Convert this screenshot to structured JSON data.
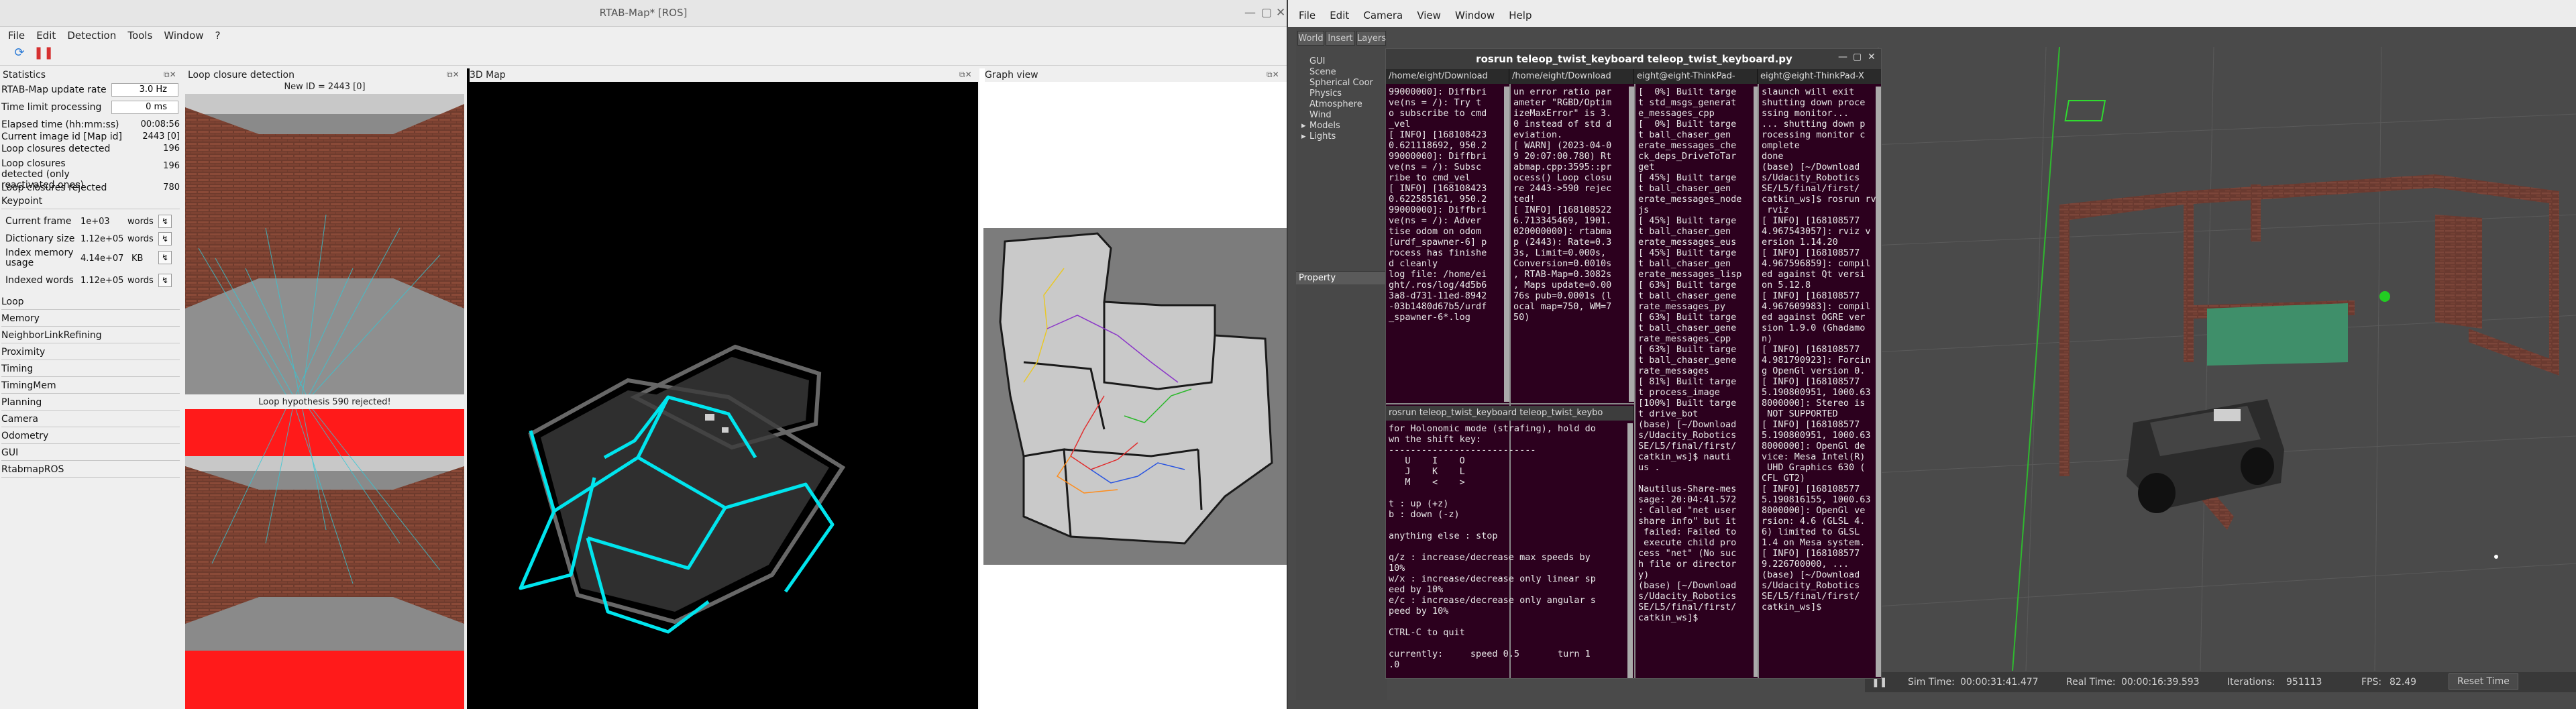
{
  "rtab": {
    "title": "RTAB-Map* [ROS]",
    "menu": [
      "File",
      "Edit",
      "Detection",
      "Tools",
      "Window",
      "?"
    ],
    "panels": {
      "statistics": "Statistics",
      "loop_closure": "Loop closure detection",
      "map3d": "3D Map",
      "graph": "Graph view"
    },
    "stats": {
      "update_rate_label": "RTAB-Map update rate",
      "update_rate_value": "3.0 Hz",
      "time_limit_label": "Time limit processing",
      "time_limit_value": "0 ms",
      "elapsed_label": "Elapsed time (hh:mm:ss)",
      "elapsed_value": "00:08:56",
      "current_image_label": "Current image id [Map id]",
      "current_image_value": "2443 [0]",
      "lc_detected_label": "Loop closures detected",
      "lc_detected_value": "196",
      "lc_reactivated_label": "Loop closures detected (only reactivated ones)",
      "lc_reactivated_value": "196",
      "lc_rejected_label": "Loop closures rejected",
      "lc_rejected_value": "780",
      "keypoint_section": "Keypoint",
      "current_frame_label": "Current frame",
      "current_frame_value": "1e+03",
      "current_frame_unit": "words",
      "dictionary_label": "Dictionary size",
      "dictionary_value": "1.12e+05",
      "dictionary_unit": "words",
      "index_memory_label": "Index memory usage",
      "index_memory_value": "4.14e+07",
      "index_memory_unit": "KB",
      "indexed_words_label": "Indexed words",
      "indexed_words_value": "1.12e+05",
      "indexed_words_unit": "words",
      "sections": [
        "Loop",
        "Memory",
        "NeighborLinkRefining",
        "Proximity",
        "Timing",
        "TimingMem",
        "Planning",
        "Camera",
        "Odometry",
        "GUI",
        "RtabmapROS"
      ]
    },
    "loop": {
      "new_id": "New ID = 2443 [0]",
      "hypothesis": "Loop hypothesis 590 rejected!"
    }
  },
  "gazebo": {
    "menu": [
      "File",
      "Edit",
      "Camera",
      "View",
      "Window",
      "Help"
    ],
    "tabs": [
      "World",
      "Insert",
      "Layers"
    ],
    "tree": [
      "GUI",
      "Scene",
      "Spherical Coor",
      "Physics",
      "Atmosphere",
      "Wind",
      "Models",
      "Lights"
    ],
    "property": "Property",
    "status": {
      "sim_time_label": "Sim Time:",
      "sim_time": "00:00:31:41.477",
      "real_time_label": "Real Time:",
      "real_time": "00:00:16:39.593",
      "iter_label": "Iterations:",
      "iter": "951113",
      "fps_label": "FPS:",
      "fps": "82.49",
      "reset": "Reset Time"
    }
  },
  "terminal": {
    "title": "rosrun teleop_twist_keyboard teleop_twist_keyboard.py",
    "tabs": [
      "/home/eight/Download",
      "/home/eight/Download",
      "eight@eight-ThinkPad-",
      "eight@eight-ThinkPad-X"
    ],
    "bottom_tab": "rosrun teleop_twist_keyboard teleop_twist_keybo",
    "pane1": "99000000]: Diffbri\nve(ns = /): Try t\no subscribe to cmd\n_vel\n[ INFO] [168108423\n0.621118692, 950.2\n99000000]: Diffbri\nve(ns = /): Subsc\nribe to cmd_vel\n[ INFO] [168108423\n0.622585161, 950.2\n99000000]: Diffbri\nve(ns = /): Adver\ntise odom on odom\n[urdf_spawner-6] p\nrocess has finishe\nd cleanly\nlog file: /home/ei\nght/.ros/log/4d5b6\n3a8-d731-11ed-8942\n-03b1480d67b5/urdf\n_spawner-6*.log",
    "pane2": "un error ratio par\nameter \"RGBD/Optim\nizeMaxError\" is 3.\n0 instead of std d\neviation.\n[ WARN] (2023-04-0\n9 20:07:00.780) Rt\nabmap.cpp:3595::pr\nocess() Loop closu\nre 2443->590 rejec\nted!\n[ INFO] [168108522\n6.713345469, 1901.\n020000000]: rtabma\np (2443): Rate=0.3\n3s, Limit=0.000s,\nConversion=0.0010s\n, RTAB-Map=0.3082s\n, Maps update=0.00\n76s pub=0.0001s (l\nocal map=750, WM=7\n50)",
    "pane3": "[  0%] Built targe\nt std_msgs_generat\ne_messages_cpp\n[  0%] Built targe\nt ball_chaser_gen\nerate_messages_che\nck_deps_DriveToTar\nget\n[ 45%] Built targe\nt ball_chaser_gen\nerate_messages_node\njs\n[ 45%] Built targe\nt ball_chaser_gen\nerate_messages_eus\n[ 45%] Built targe\nt ball_chaser_gen\nerate_messages_lisp\n[ 63%] Built targe\nt ball_chaser_gene\nrate_messages_py\n[ 63%] Built targe\nt ball_chaser_gene\nrate_messages_cpp\n[ 63%] Built targe\nt ball_chaser_gene\nrate_messages\n[ 81%] Built targe\nt process_image\n[100%] Built targe\nt drive_bot\n(base) [~/Download\ns/Udacity_Robotics\nSE/L5/final/first/\ncatkin_ws]$ nauti\nus .\n\nNautilus-Share-mes\nsage: 20:04:41.572\n: Called \"net user\nshare info\" but it\n failed: Failed to\n execute child pro\ncess \"net\" (No suc\nh file or director\ny)\n(base) [~/Download\ns/Udacity_Robotics\nSE/L5/final/first/\ncatkin_ws]$ ",
    "pane4": "slaunch will exit\nshutting down proce\nssing monitor...\n... shutting down p\nrocessing monitor c\nomplete\ndone\n(base) [~/Download\ns/Udacity_Robotics\nSE/L5/final/first/\ncatkin_ws]$ rosrun rviz\n rviz\n[ INFO] [168108577\n4.967543057]: rviz v\nersion 1.14.20\n[ INFO] [168108577\n4.967596859]: compil\ned against Qt versi\non 5.12.8\n[ INFO] [168108577\n4.967609983]: compil\ned against OGRE ver\nsion 1.9.0 (Ghadamo\nn)\n[ INFO] [168108577\n4.981790923]: Forcin\ng OpenGl version 0.\n[ INFO] [168108577\n5.190800951, 1000.63\n8000000]: Stereo is\n NOT SUPPORTED\n[ INFO] [168108577\n5.190800951, 1000.63\n8000000]: OpenGl de\nvice: Mesa Intel(R)\n UHD Graphics 630 (\nCFL GT2)\n[ INFO] [168108577\n5.190816155, 1000.63\n8000000]: OpenGl ve\nrsion: 4.6 (GLSL 4.\n6) limited to GLSL\n1.4 on Mesa system.\n[ INFO] [168108577\n9.226700000, ...\n(base) [~/Download\ns/Udacity_Robotics\nSE/L5/final/first/\ncatkin_ws]$ ",
    "pane5": "for Holonomic mode (strafing), hold do\nwn the shift key:\n---------------------------\n   U    I    O\n   J    K    L\n   M    <    >\n\nt : up (+z)\nb : down (-z)\n\nanything else : stop\n\nq/z : increase/decrease max speeds by\n10%\nw/x : increase/decrease only linear sp\need by 10%\ne/c : increase/decrease only angular s\npeed by 10%\n\nCTRL-C to quit\n\ncurrently:     speed 0.5       turn 1\n.0"
  }
}
